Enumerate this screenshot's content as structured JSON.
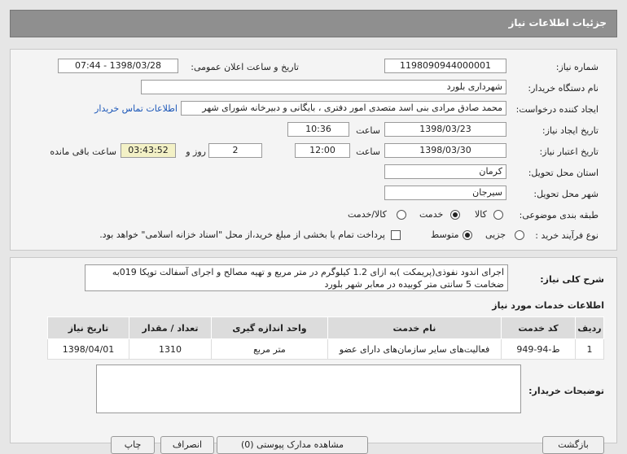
{
  "page_title": "جزئیات اطلاعات نیاز",
  "fields": {
    "need_number_label": "شماره نیاز:",
    "need_number": "1198090944000001",
    "announce_label": "تاریخ و ساعت اعلان عمومی:",
    "announce_value": "1398/03/28 - 07:44",
    "buyer_org_label": "نام دستگاه خریدار:",
    "buyer_org": "شهرداری بلورد",
    "requester_label": "ایجاد کننده درخواست:",
    "requester": "محمد صادق مرادی بنی اسد  متصدی امور دفتری ، بایگانی و دبیرخانه شورای شهر",
    "contact_link": "اطلاعات تماس خریدار",
    "created_label": "تاریخ ایجاد نیاز:",
    "created_date": "1398/03/23",
    "time_label": "ساعت",
    "created_time": "10:36",
    "validity_label": "تاریخ اعتبار نیاز:",
    "validity_date": "1398/03/30",
    "validity_time": "12:00",
    "days_value": "2",
    "days_label": "روز و",
    "remaining_time": "03:43:52",
    "remaining_label": "ساعت باقی مانده",
    "province_label": "استان محل تحویل:",
    "province": "کرمان",
    "city_label": "شهر محل تحویل:",
    "city": "سیرجان",
    "category_label": "طبقه بندی موضوعی:",
    "category_options": [
      "کالا",
      "خدمت",
      "کالا/خدمت"
    ],
    "category_selected": "خدمت",
    "process_label": "نوع فرآیند خرید :",
    "process_options": [
      "جزیی",
      "متوسط"
    ],
    "process_selected": "متوسط",
    "payment_note": "پرداخت تمام یا بخشی از مبلغ خرید،از محل \"اسناد خزانه اسلامی\" خواهد بود."
  },
  "description": {
    "label": "شرح کلی نیاز:",
    "text": "اجرای اندود نفوذی(پریمکت )به ازای 1.2 کیلوگرم در متر مربع و تهیه مصالح و اجرای آسفالت توپکا 019به ضخامت 5 سانتی متر کوبیده در معابر شهر بلورد"
  },
  "services": {
    "heading": "اطلاعات خدمات مورد نیاز",
    "columns": [
      "ردیف",
      "کد خدمت",
      "نام خدمت",
      "واحد اندازه گیری",
      "تعداد / مقدار",
      "تاریخ نیاز"
    ],
    "rows": [
      [
        "1",
        "ط-94-949",
        "فعالیت‌های سایر سازمان‌های دارای عضو",
        "متر مربع",
        "1310",
        "1398/04/01"
      ]
    ]
  },
  "buyer_notes": {
    "label": "توضیحات خریدار:",
    "value": ""
  },
  "footer_buttons": [
    "بازگشت",
    "مشاهده مدارک پیوستی (0)",
    "انصراف",
    "چاپ"
  ]
}
